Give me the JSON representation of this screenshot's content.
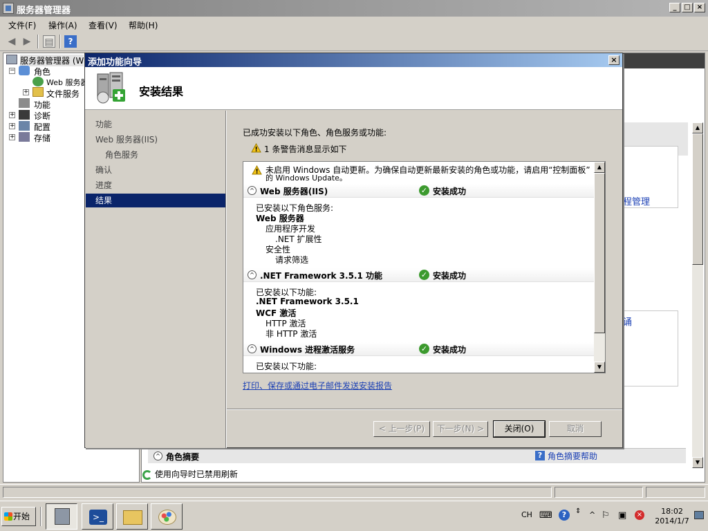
{
  "window": {
    "title": "服务器管理器"
  },
  "menubar": {
    "items": [
      "文件(F)",
      "操作(A)",
      "查看(V)",
      "帮助(H)"
    ]
  },
  "tree": {
    "root": "服务器管理器 (W",
    "roles": "角色",
    "web_server": "Web 服务器",
    "file_services": "文件服务",
    "features": "功能",
    "diagnostics": "诊断",
    "config": "配置",
    "storage": "存储"
  },
  "background": {
    "link1": "程管理",
    "link2": "诵",
    "role_summary": "角色摘要",
    "role_summary_help": "角色摘要帮助",
    "status_text": "使用向导时已禁用刷新"
  },
  "dialog": {
    "title": "添加功能向导",
    "heading": "安装结果",
    "nav": [
      {
        "label": "功能",
        "sub": false,
        "active": false
      },
      {
        "label": "Web 服务器(IIS)",
        "sub": false,
        "active": false
      },
      {
        "label": "角色服务",
        "sub": true,
        "active": false
      },
      {
        "label": "确认",
        "sub": false,
        "active": false
      },
      {
        "label": "进度",
        "sub": false,
        "active": false
      },
      {
        "label": "结果",
        "sub": false,
        "active": true
      }
    ],
    "intro": "已成功安装以下角色、角色服务或功能:",
    "warning_summary": "1 条警告消息显示如下",
    "warning_line1": "未启用 Windows 自动更新。为确保自动更新最新安装的角色或功能，请启用“控制面板”",
    "warning_line2": "的 Windows Update。",
    "sections": [
      {
        "title": "Web 服务器(IIS)",
        "status": "安装成功",
        "lines": [
          {
            "text": "已安装以下角色服务:",
            "indent": 0,
            "bold": false
          },
          {
            "text": "Web 服务器",
            "indent": 0,
            "bold": true
          },
          {
            "text": "应用程序开发",
            "indent": 1,
            "bold": false
          },
          {
            "text": ".NET 扩展性",
            "indent": 2,
            "bold": false
          },
          {
            "text": "安全性",
            "indent": 1,
            "bold": false
          },
          {
            "text": "请求筛选",
            "indent": 2,
            "bold": false
          }
        ]
      },
      {
        "title": ".NET Framework 3.5.1 功能",
        "status": "安装成功",
        "lines": [
          {
            "text": "已安装以下功能:",
            "indent": 0,
            "bold": false
          },
          {
            "text": ".NET Framework 3.5.1",
            "indent": 0,
            "bold": true
          },
          {
            "text": "WCF 激活",
            "indent": 0,
            "bold": true
          },
          {
            "text": "HTTP 激活",
            "indent": 1,
            "bold": false
          },
          {
            "text": "非 HTTP 激活",
            "indent": 1,
            "bold": false
          }
        ]
      },
      {
        "title": "Windows 进程激活服务",
        "status": "安装成功",
        "lines": [
          {
            "text": "已安装以下功能:",
            "indent": 0,
            "bold": false
          }
        ]
      }
    ],
    "print_link": "打印、保存或通过电子邮件发送安装报告",
    "buttons": {
      "prev": "< 上一步(P)",
      "next": "下一步(N) >",
      "close": "关闭(O)",
      "cancel": "取消"
    }
  },
  "taskbar": {
    "start": "开始",
    "lang": "CH",
    "time": "18:02",
    "date": "2014/1/7"
  }
}
